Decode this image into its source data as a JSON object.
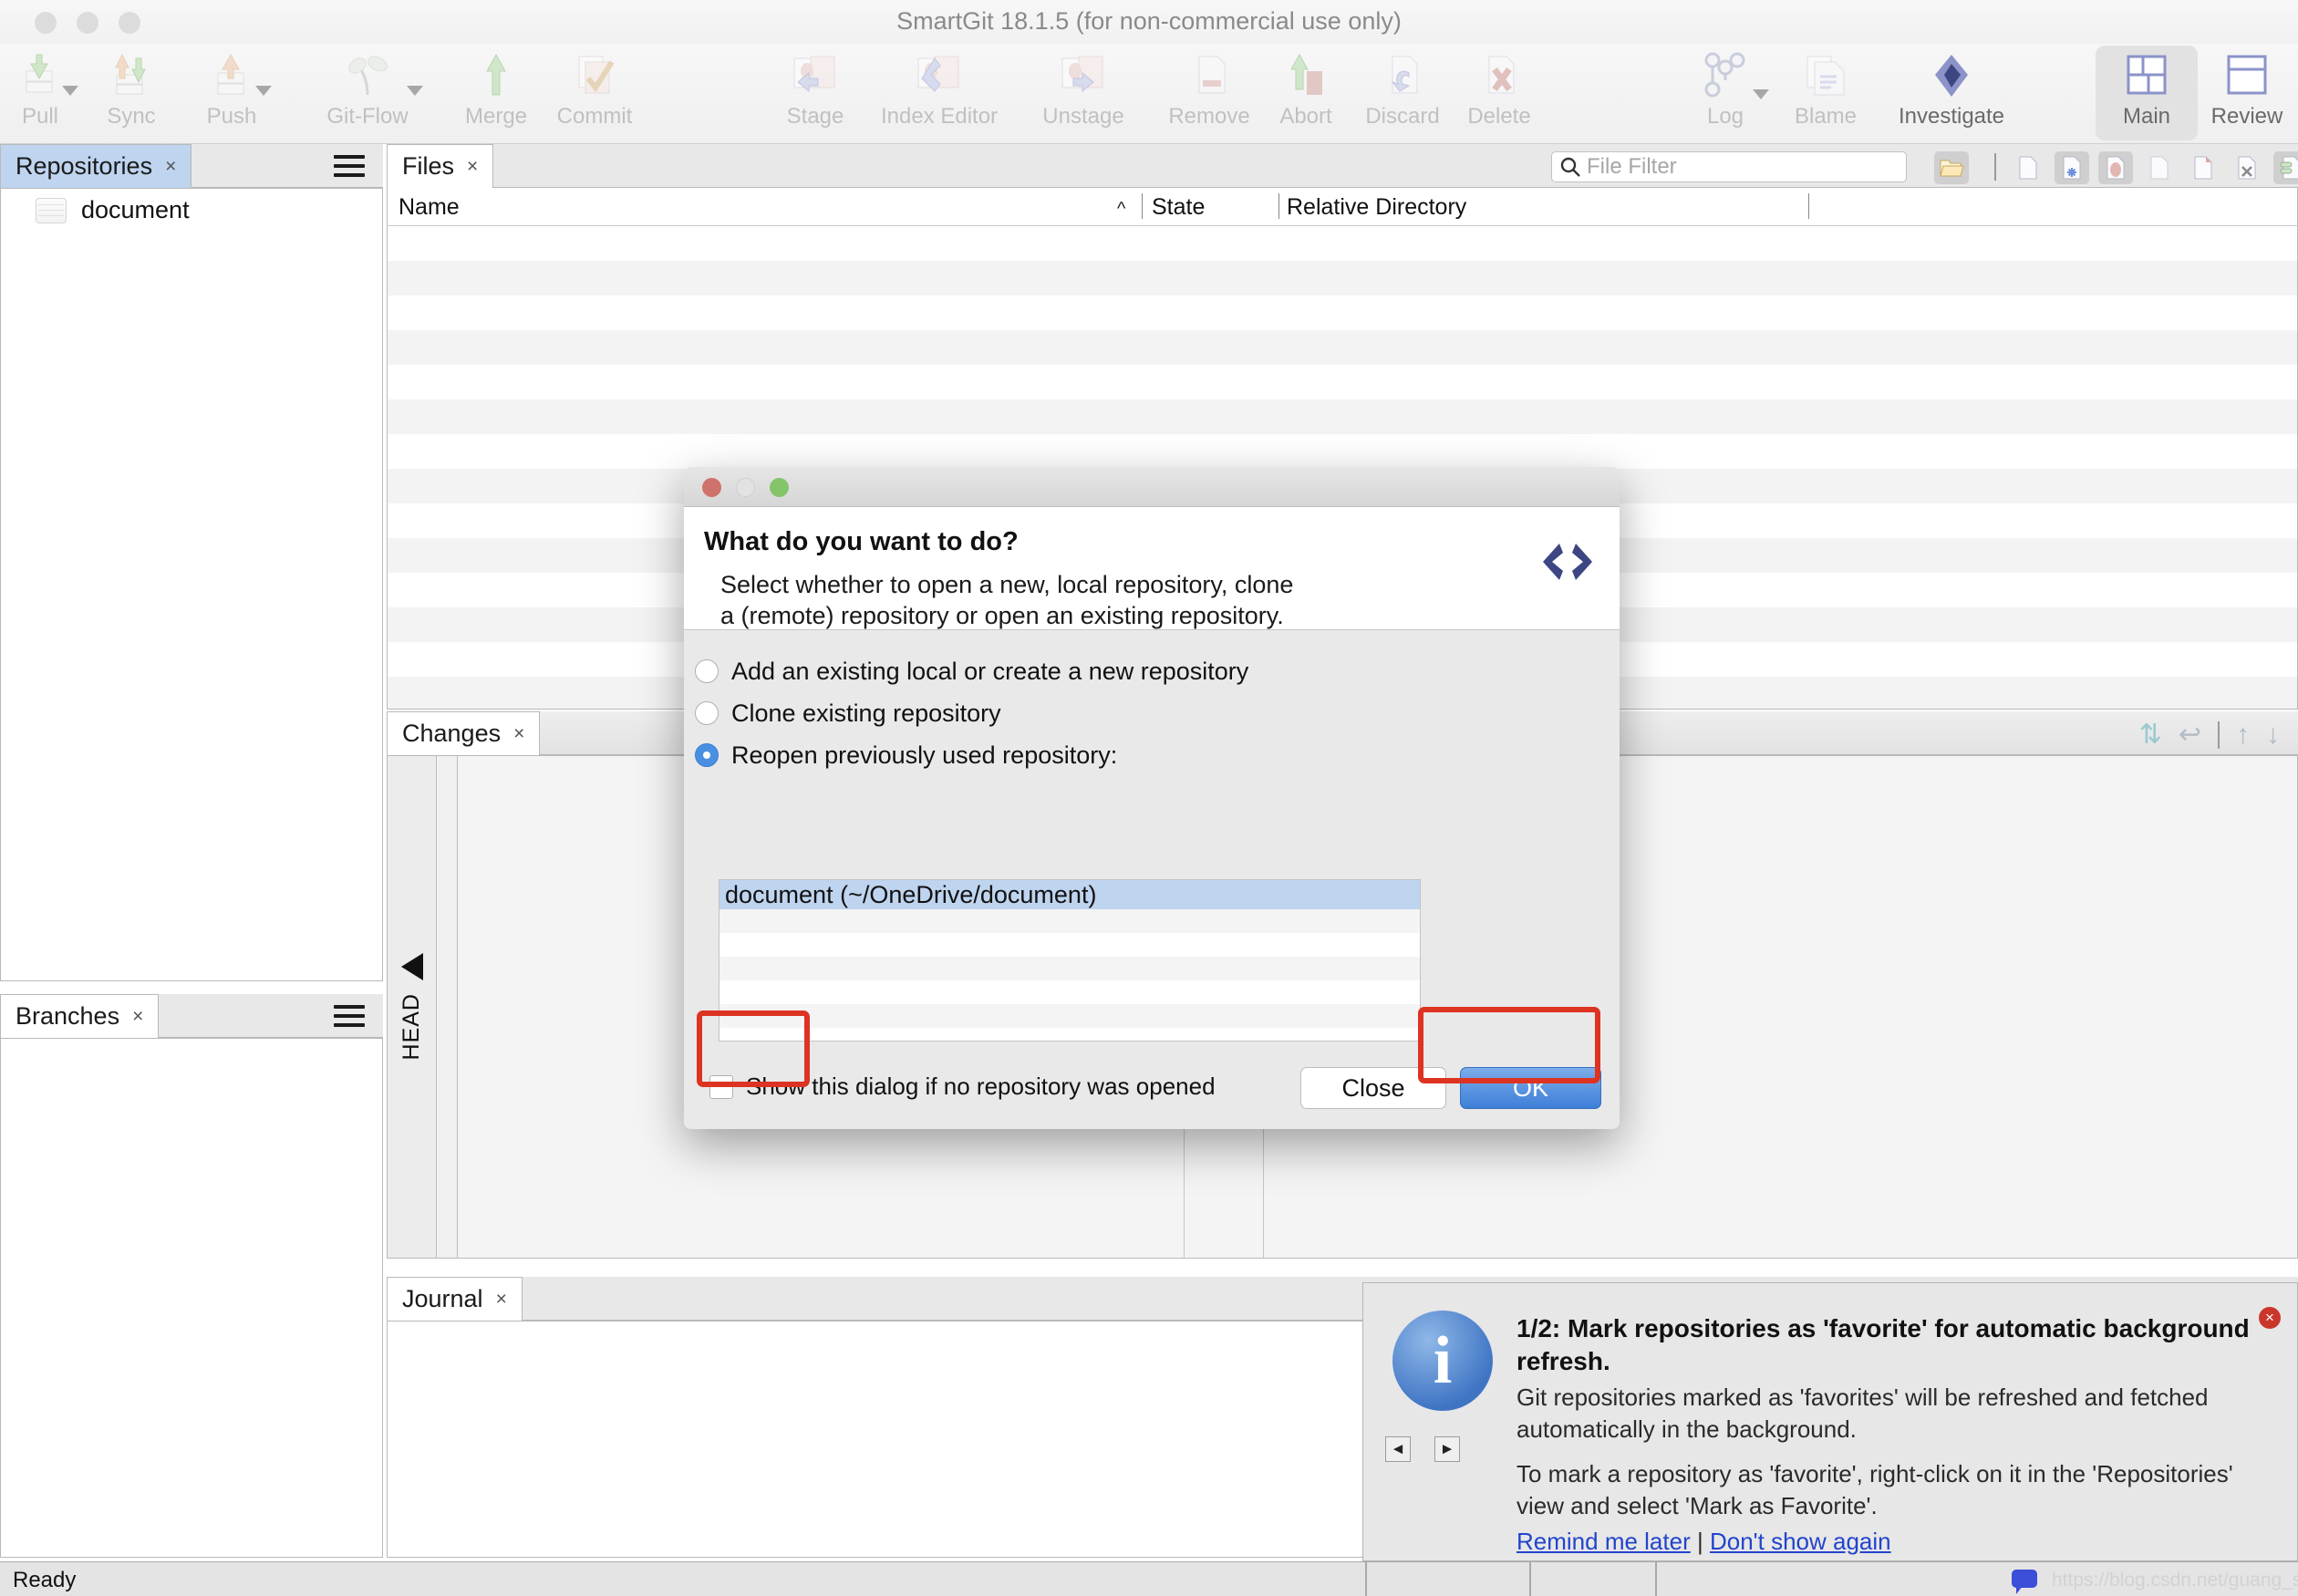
{
  "window": {
    "title": "SmartGit 18.1.5 (for non-commercial use only)"
  },
  "toolbar": {
    "items": [
      {
        "label": "Pull",
        "icon": "pull-icon",
        "caret": true,
        "enabled": false
      },
      {
        "label": "Sync",
        "icon": "sync-icon",
        "caret": false,
        "enabled": false
      },
      {
        "label": "Push",
        "icon": "push-icon",
        "caret": true,
        "enabled": false
      },
      {
        "label": "Git-Flow",
        "icon": "git-flow-icon",
        "caret": true,
        "enabled": false
      },
      {
        "label": "Merge",
        "icon": "merge-icon",
        "caret": false,
        "enabled": false
      },
      {
        "label": "Commit",
        "icon": "commit-icon",
        "caret": false,
        "enabled": false
      },
      {
        "label": "Stage",
        "icon": "stage-icon",
        "caret": false,
        "enabled": false
      },
      {
        "label": "Index Editor",
        "icon": "index-editor-icon",
        "caret": false,
        "enabled": false
      },
      {
        "label": "Unstage",
        "icon": "unstage-icon",
        "caret": false,
        "enabled": false
      },
      {
        "label": "Remove",
        "icon": "remove-icon",
        "caret": false,
        "enabled": false
      },
      {
        "label": "Abort",
        "icon": "abort-icon",
        "caret": false,
        "enabled": false
      },
      {
        "label": "Discard",
        "icon": "discard-icon",
        "caret": false,
        "enabled": false
      },
      {
        "label": "Delete",
        "icon": "delete-icon",
        "caret": false,
        "enabled": false
      },
      {
        "label": "Log",
        "icon": "log-icon",
        "caret": true,
        "enabled": false
      },
      {
        "label": "Blame",
        "icon": "blame-icon",
        "caret": false,
        "enabled": false
      },
      {
        "label": "Investigate",
        "icon": "investigate-icon",
        "caret": false,
        "enabled": true
      },
      {
        "label": "Main",
        "icon": "layout-main-icon",
        "caret": false,
        "enabled": true
      },
      {
        "label": "Review",
        "icon": "layout-review-icon",
        "caret": false,
        "enabled": true
      }
    ],
    "selected_layout": "Main"
  },
  "repositories": {
    "tab_label": "Repositories",
    "tab_close": "×",
    "menu_icon": "hamburger-icon",
    "items": [
      {
        "name": "document",
        "icon": "repository-icon"
      }
    ]
  },
  "branches": {
    "tab_label": "Branches",
    "tab_close": "×",
    "menu_icon": "hamburger-icon",
    "items": []
  },
  "files": {
    "tab_label": "Files",
    "tab_close": "×",
    "filter_placeholder": "File Filter",
    "filter_value": "",
    "search_icon": "search-icon",
    "columns": [
      "Name",
      "State",
      "Relative Directory"
    ],
    "sort_column": "Name",
    "sort_direction": "ascending",
    "rows": [],
    "toolbar_icons": [
      "open-folder-icon",
      "new-file-icon",
      "new-untracked-file-icon",
      "modified-file-icon",
      "unchanged-file-icon",
      "added-file-icon",
      "missing-file-icon",
      "staged-file-icon",
      "ignored-file-icon"
    ]
  },
  "changes": {
    "tab_label": "Changes",
    "tab_close": "×",
    "head_label": "HEAD",
    "tools": [
      "swap-sides-icon",
      "return-icon",
      "previous-change-icon",
      "next-change-icon"
    ]
  },
  "journal": {
    "tab_label": "Journal",
    "tab_close": "×",
    "entries": []
  },
  "statusbar": {
    "text": "Ready",
    "watermark": "https://blog.csdn.net/guang_s",
    "bubble_icon": "speech-bubble-icon"
  },
  "notification": {
    "title": "1/2: Mark repositories as 'favorite' for automatic background refresh.",
    "paragraph1": "Git repositories marked as 'favorites' will be refreshed and fetched automatically in the background.",
    "paragraph2": "To mark a repository as 'favorite', right-click on it in the 'Repositories' view and select 'Mark as Favorite'.",
    "link_remind": "Remind me later",
    "link_separator": "|",
    "link_dismiss": "Don't show again",
    "info_glyph": "i",
    "prev_glyph": "◄",
    "next_glyph": "►",
    "close_glyph": "×",
    "icon": "info-icon"
  },
  "dialog": {
    "heading": "What do you want to do?",
    "subtitle": "Select whether to open a new, local repository, clone a (remote) repository or open an existing repository.",
    "logo_icon": "smartgit-chevron-logo",
    "options": [
      {
        "label": "Add an existing local or create a new repository",
        "selected": false
      },
      {
        "label": "Clone existing repository",
        "selected": false
      },
      {
        "label": "Reopen previously used repository:",
        "selected": true
      }
    ],
    "repo_list": [
      {
        "label": "document (~/OneDrive/document)",
        "selected": true
      }
    ],
    "checkbox_label": "Show this dialog if no repository was opened",
    "checkbox_checked": false,
    "close_label": "Close",
    "ok_label": "OK"
  },
  "colors": {
    "accent_blue": "#4a90e2",
    "selection_blue": "#bed4ef",
    "annotation_red": "#dd3322",
    "ok_button": "#3e7fd8",
    "info_blue": "#3f74c4"
  }
}
